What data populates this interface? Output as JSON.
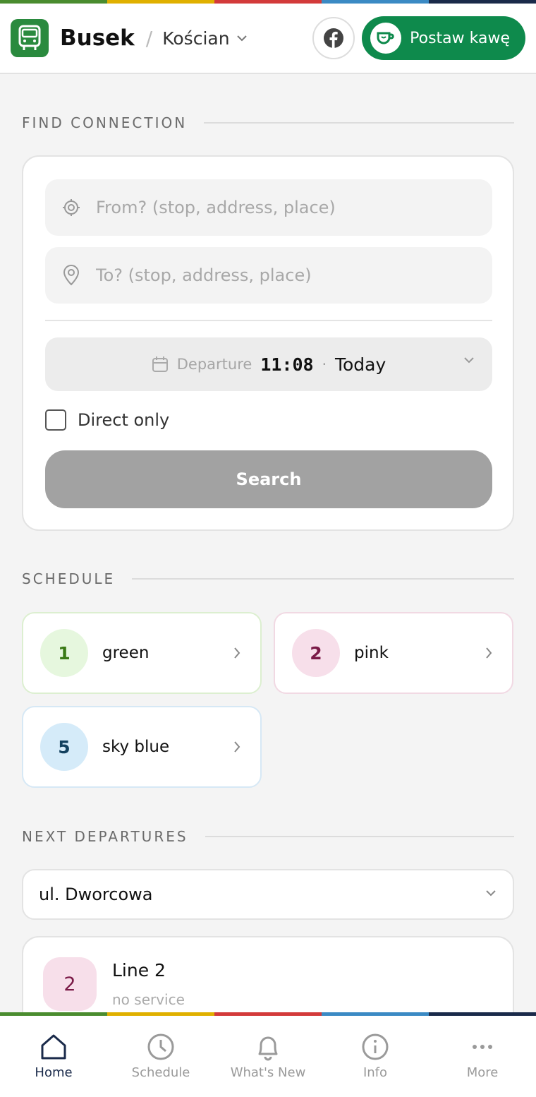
{
  "stripe_colors": [
    "#4a8c2f",
    "#e0b000",
    "#d33a3a",
    "#3b8ac4",
    "#1a2a4a"
  ],
  "header": {
    "brand": "Busek",
    "city": "Kościan",
    "coffee_label": "Postaw kawę"
  },
  "find": {
    "section_title": "FIND CONNECTION",
    "from_placeholder": "From? (stop, address, place)",
    "to_placeholder": "To? (stop, address, place)",
    "departure_label": "Departure",
    "departure_time": "11:08",
    "departure_separator": "·",
    "departure_day": "Today",
    "direct_only_label": "Direct only",
    "direct_only_checked": false,
    "search_label": "Search"
  },
  "schedule": {
    "section_title": "SCHEDULE",
    "routes": [
      {
        "number": "1",
        "name": "green",
        "bg": "#e6f7de",
        "fg": "#3a7a16",
        "border": "#dcefd0"
      },
      {
        "number": "2",
        "name": "pink",
        "bg": "#f7dfea",
        "fg": "#7a1a47",
        "border": "#f1d9e3"
      },
      {
        "number": "5",
        "name": "sky blue",
        "bg": "#d5ebf9",
        "fg": "#12405e",
        "border": "#d6e8f5"
      }
    ]
  },
  "next": {
    "section_title": "NEXT DEPARTURES",
    "stop": "ul. Dworcowa",
    "departures": [
      {
        "badge": "2",
        "line": "Line 2",
        "status": "no service"
      }
    ]
  },
  "nav": {
    "items": [
      {
        "label": "Home",
        "icon": "home-icon",
        "active": true
      },
      {
        "label": "Schedule",
        "icon": "clock-icon",
        "active": false
      },
      {
        "label": "What's New",
        "icon": "bell-icon",
        "active": false
      },
      {
        "label": "Info",
        "icon": "info-icon",
        "active": false
      },
      {
        "label": "More",
        "icon": "more-icon",
        "active": false
      }
    ]
  }
}
